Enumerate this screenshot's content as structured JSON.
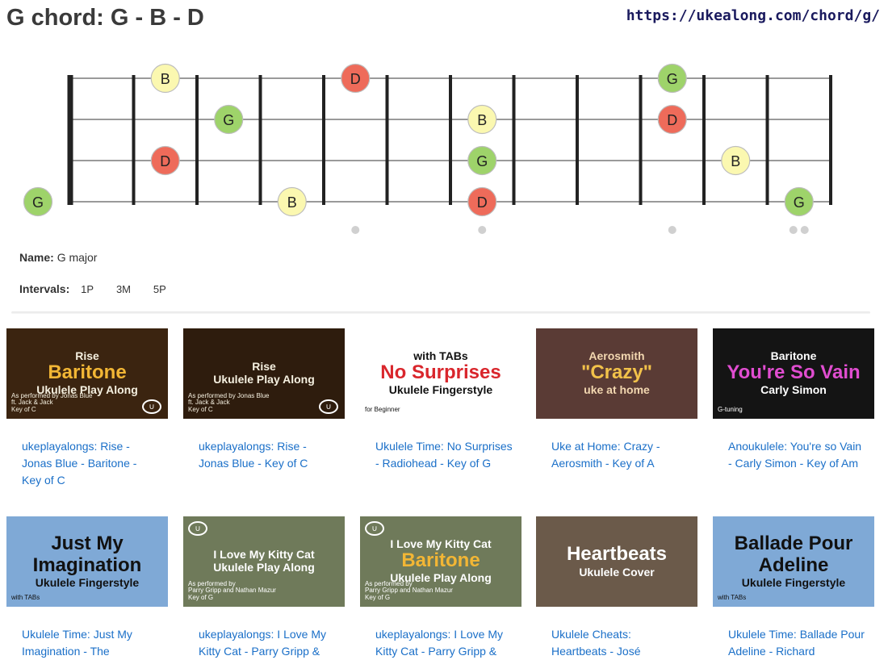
{
  "header": {
    "title": "G chord: G - B - D",
    "url": "https://ukealong.com/chord/g/"
  },
  "fretboard": {
    "frets": 12,
    "strings": 4,
    "marker_frets": [
      5,
      7,
      10,
      12
    ],
    "colors": {
      "G": "#9ed36a",
      "B": "#fbf8b0",
      "D": "#ee6b5a"
    },
    "notes": [
      {
        "string": 1,
        "fret": 2,
        "label": "B"
      },
      {
        "string": 1,
        "fret": 5,
        "label": "D"
      },
      {
        "string": 1,
        "fret": 10,
        "label": "G"
      },
      {
        "string": 2,
        "fret": 3,
        "label": "G"
      },
      {
        "string": 2,
        "fret": 7,
        "label": "B"
      },
      {
        "string": 2,
        "fret": 10,
        "label": "D"
      },
      {
        "string": 3,
        "fret": 2,
        "label": "D"
      },
      {
        "string": 3,
        "fret": 7,
        "label": "G"
      },
      {
        "string": 3,
        "fret": 11,
        "label": "B"
      },
      {
        "string": 4,
        "fret": 0,
        "label": "G"
      },
      {
        "string": 4,
        "fret": 4,
        "label": "B"
      },
      {
        "string": 4,
        "fret": 7,
        "label": "D"
      },
      {
        "string": 4,
        "fret": 12,
        "label": "G"
      }
    ]
  },
  "info": {
    "name_label": "Name:",
    "name_value": "G major",
    "intervals_label": "Intervals:",
    "intervals": [
      "1P",
      "3M",
      "5P"
    ]
  },
  "videos": [
    {
      "caption": "ukeplayalongs: Rise - Jonas Blue - Baritone - Key of C",
      "thumb": {
        "line1": "Rise",
        "line2": "Baritone",
        "line3": "Ukulele Play Along",
        "line4": "As performed by Jonas Blue\nft. Jack & Jack\nKey of C",
        "bg": "#3b2410",
        "fg": "#f5f0e0",
        "accent": "#f2b635"
      }
    },
    {
      "caption": "ukeplayalongs: Rise - Jonas Blue - Key of C",
      "thumb": {
        "line1": "Rise",
        "line2": "",
        "line3": "Ukulele Play Along",
        "line4": "As performed by Jonas Blue\nft. Jack & Jack\nKey of C",
        "bg": "#2e1c0d",
        "fg": "#f5f0e0",
        "accent": "#f5f0e0"
      }
    },
    {
      "caption": "Ukulele Time: No Surprises - Radiohead - Key of G",
      "thumb": {
        "line1": "with TABs",
        "line2": "No Surprises",
        "line3": "Ukulele Fingerstyle",
        "line4": "for Beginner",
        "bg": "#ffffff",
        "fg": "#111111",
        "accent": "#d9262c"
      }
    },
    {
      "caption": "Uke at Home: Crazy - Aerosmith - Key of A",
      "thumb": {
        "line1": "Aerosmith",
        "line2": "\"Crazy\"",
        "line3": "uke at home",
        "line4": "",
        "bg": "#5a3b35",
        "fg": "#f2d7b0",
        "accent": "#f2c24a"
      }
    },
    {
      "caption": "Anoukulele: You're so Vain - Carly Simon - Key of Am",
      "thumb": {
        "line1": "Baritone",
        "line2": "You're So Vain",
        "line3": "Carly Simon",
        "line4": "G-tuning",
        "bg": "#141414",
        "fg": "#ffffff",
        "accent": "#e04dd0"
      }
    },
    {
      "caption": "Ukulele Time: Just My Imagination - The",
      "thumb": {
        "line1": "",
        "line2": "Just My Imagination",
        "line3": "Ukulele Fingerstyle",
        "line4": "with TABs",
        "bg": "#7fa9d6",
        "fg": "#111111",
        "accent": "#111111"
      }
    },
    {
      "caption": "ukeplayalongs: I Love My Kitty Cat - Parry Gripp &",
      "thumb": {
        "line1": "I Love My Kitty Cat",
        "line2": "",
        "line3": "Ukulele Play Along",
        "line4": "As performed by\nParry Gripp and Nathan Mazur\nKey of G",
        "bg": "#6f7a5a",
        "fg": "#ffffff",
        "accent": "#ffffff"
      }
    },
    {
      "caption": "ukeplayalongs: I Love My Kitty Cat - Parry Gripp &",
      "thumb": {
        "line1": "I Love My Kitty Cat",
        "line2": "Baritone",
        "line3": "Ukulele Play Along",
        "line4": "As performed by\nParry Gripp and Nathan Mazur\nKey of G",
        "bg": "#6f7a5a",
        "fg": "#ffffff",
        "accent": "#f2b635"
      }
    },
    {
      "caption": "Ukulele Cheats: Heartbeats - José",
      "thumb": {
        "line1": "",
        "line2": "Heartbeats",
        "line3": "Ukulele Cover",
        "line4": "",
        "bg": "#6b5a4a",
        "fg": "#ffffff",
        "accent": "#ffffff"
      }
    },
    {
      "caption": "Ukulele Time: Ballade Pour Adeline - Richard",
      "thumb": {
        "line1": "",
        "line2": "Ballade Pour Adeline",
        "line3": "Ukulele Fingerstyle",
        "line4": "with TABs",
        "bg": "#7fa9d6",
        "fg": "#111111",
        "accent": "#111111"
      }
    }
  ]
}
